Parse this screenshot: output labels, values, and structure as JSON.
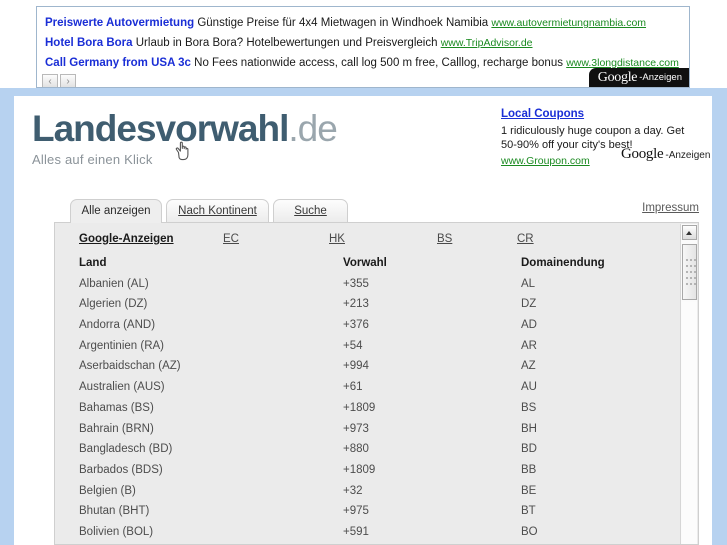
{
  "banner_ads": {
    "items": [
      {
        "title": "Preiswerte Autovermietung",
        "desc": "Günstige Preise für 4x4 Mietwagen in Windhoek Namibia",
        "url": "www.autovermietungnambia.com"
      },
      {
        "title": "Hotel Bora Bora",
        "desc": "Urlaub in Bora Bora? Hotelbewertungen und Preisvergleich",
        "url": "www.TripAdvisor.de"
      },
      {
        "title": "Call Germany from USA 3c",
        "desc": "No Fees nationwide access, call log 500 m free, Calllog, recharge bonus",
        "url": "www.3longdistance.com"
      }
    ],
    "prev_label": "‹",
    "next_label": "›",
    "badge_brand": "Google",
    "badge_suffix": "-Anzeigen"
  },
  "header": {
    "logo_main": "Landesvorwahl",
    "logo_suffix": ".de",
    "tagline": "Alles auf einen Klick",
    "coupon": {
      "title": "Local Coupons",
      "desc": "1 ridiculously huge coupon a day. Get 50-90% off your city's best!",
      "url": "www.Groupon.com"
    },
    "badge_brand": "Google",
    "badge_suffix": "-Anzeigen"
  },
  "tabs": [
    {
      "label": "Alle anzeigen",
      "active": true
    },
    {
      "label": "Nach Kontinent",
      "active": false
    },
    {
      "label": "Suche",
      "active": false
    }
  ],
  "impressum_label": "Impressum",
  "ad_links": {
    "title": "Google-Anzeigen",
    "codes": [
      "EC",
      "HK",
      "BS",
      "CR"
    ]
  },
  "table": {
    "headers": {
      "land": "Land",
      "vorwahl": "Vorwahl",
      "domain": "Domainendung"
    },
    "rows": [
      {
        "land": "Albanien (AL)",
        "vorwahl": "+355",
        "domain": "AL"
      },
      {
        "land": "Algerien (DZ)",
        "vorwahl": "+213",
        "domain": "DZ"
      },
      {
        "land": "Andorra (AND)",
        "vorwahl": "+376",
        "domain": "AD"
      },
      {
        "land": "Argentinien (RA)",
        "vorwahl": "+54",
        "domain": "AR"
      },
      {
        "land": "Aserbaidschan (AZ)",
        "vorwahl": "+994",
        "domain": "AZ"
      },
      {
        "land": "Australien (AUS)",
        "vorwahl": "+61",
        "domain": "AU"
      },
      {
        "land": "Bahamas (BS)",
        "vorwahl": "+1809",
        "domain": "BS"
      },
      {
        "land": "Bahrain (BRN)",
        "vorwahl": "+973",
        "domain": "BH"
      },
      {
        "land": "Bangladesch (BD)",
        "vorwahl": "+880",
        "domain": "BD"
      },
      {
        "land": "Barbados (BDS)",
        "vorwahl": "+1809",
        "domain": "BB"
      },
      {
        "land": "Belgien (B)",
        "vorwahl": "+32",
        "domain": "BE"
      },
      {
        "land": "Bhutan (BHT)",
        "vorwahl": "+975",
        "domain": "BT"
      },
      {
        "land": "Bolivien (BOL)",
        "vorwahl": "+591",
        "domain": "BO"
      }
    ]
  },
  "colors": {
    "page_bg": "#b7d2f0",
    "logo": "#3f5d70",
    "ad_title": "#1a2ed6",
    "ad_url": "#1a8a20",
    "panel_bg": "#ebebeb"
  }
}
